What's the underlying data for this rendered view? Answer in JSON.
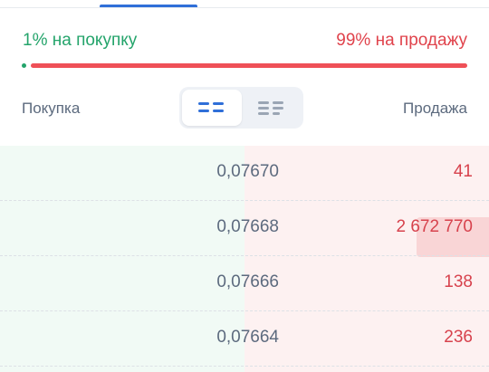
{
  "ratio": {
    "buy_text": "1% на покупку",
    "sell_text": "99% на продажу",
    "buy_percent": 1,
    "sell_percent": 99
  },
  "columns": {
    "buy_label": "Покупка",
    "sell_label": "Продажа"
  },
  "view_toggle": {
    "options": [
      "order-book-both-icon",
      "order-book-sell-icon"
    ],
    "selected": "order-book-both-icon"
  },
  "orders": [
    {
      "price": "0,07670",
      "quantity": "41"
    },
    {
      "price": "0,07668",
      "quantity": "2 672 770"
    },
    {
      "price": "0,07666",
      "quantity": "138"
    },
    {
      "price": "0,07664",
      "quantity": "236"
    }
  ],
  "colors": {
    "buy": "#24a46b",
    "sell": "#e0434c",
    "accent": "#2f6fd8"
  }
}
